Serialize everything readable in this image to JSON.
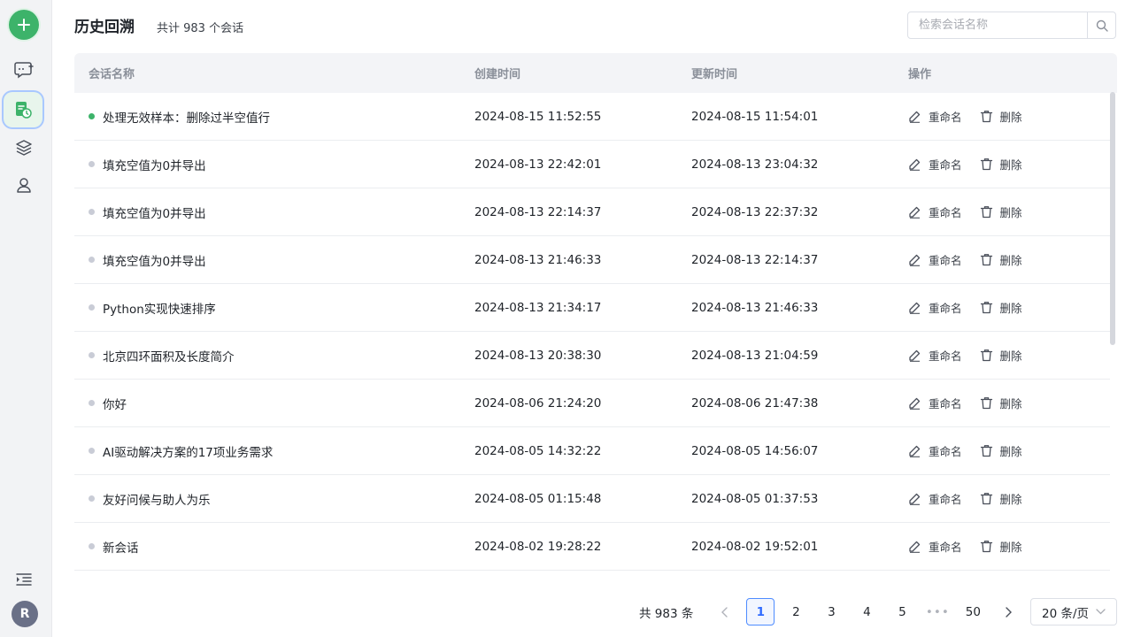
{
  "sidebar": {
    "items": [
      {
        "icon": "plus-icon",
        "active": false
      },
      {
        "icon": "new-chat-icon",
        "active": false
      },
      {
        "icon": "history-icon",
        "active": true
      },
      {
        "icon": "layers-icon",
        "active": false
      },
      {
        "icon": "user-icon",
        "active": false
      }
    ],
    "avatar_letter": "R",
    "accent": "#3db36a"
  },
  "header": {
    "title": "历史回溯",
    "count_text": "共计 983 个会话"
  },
  "search": {
    "placeholder": "检索会话名称"
  },
  "table": {
    "columns": [
      "会话名称",
      "创建时间",
      "更新时间",
      "操作"
    ],
    "rename_label": "重命名",
    "delete_label": "删除",
    "rows": [
      {
        "name": "处理无效样本：删除过半空值行",
        "created": "2024-08-15 11:52:55",
        "updated": "2024-08-15 11:54:01",
        "active": true
      },
      {
        "name": "填充空值为0并导出",
        "created": "2024-08-13 22:42:01",
        "updated": "2024-08-13 23:04:32",
        "active": false
      },
      {
        "name": "填充空值为0并导出",
        "created": "2024-08-13 22:14:37",
        "updated": "2024-08-13 22:37:32",
        "active": false
      },
      {
        "name": "填充空值为0并导出",
        "created": "2024-08-13 21:46:33",
        "updated": "2024-08-13 22:14:37",
        "active": false
      },
      {
        "name": "Python实现快速排序",
        "created": "2024-08-13 21:34:17",
        "updated": "2024-08-13 21:46:33",
        "active": false
      },
      {
        "name": "北京四环面积及长度简介",
        "created": "2024-08-13 20:38:30",
        "updated": "2024-08-13 21:04:59",
        "active": false
      },
      {
        "name": "你好",
        "created": "2024-08-06 21:24:20",
        "updated": "2024-08-06 21:47:38",
        "active": false
      },
      {
        "name": "AI驱动解决方案的17项业务需求",
        "created": "2024-08-05 14:32:22",
        "updated": "2024-08-05 14:56:07",
        "active": false
      },
      {
        "name": "友好问候与助人为乐",
        "created": "2024-08-05 01:15:48",
        "updated": "2024-08-05 01:37:53",
        "active": false
      },
      {
        "name": "新会话",
        "created": "2024-08-02 19:28:22",
        "updated": "2024-08-02 19:52:01",
        "active": false
      }
    ]
  },
  "pagination": {
    "total_text": "共 983 条",
    "pages": [
      "1",
      "2",
      "3",
      "4",
      "5"
    ],
    "current": "1",
    "ellipsis": "•••",
    "last": "50",
    "page_size": "20 条/页"
  }
}
